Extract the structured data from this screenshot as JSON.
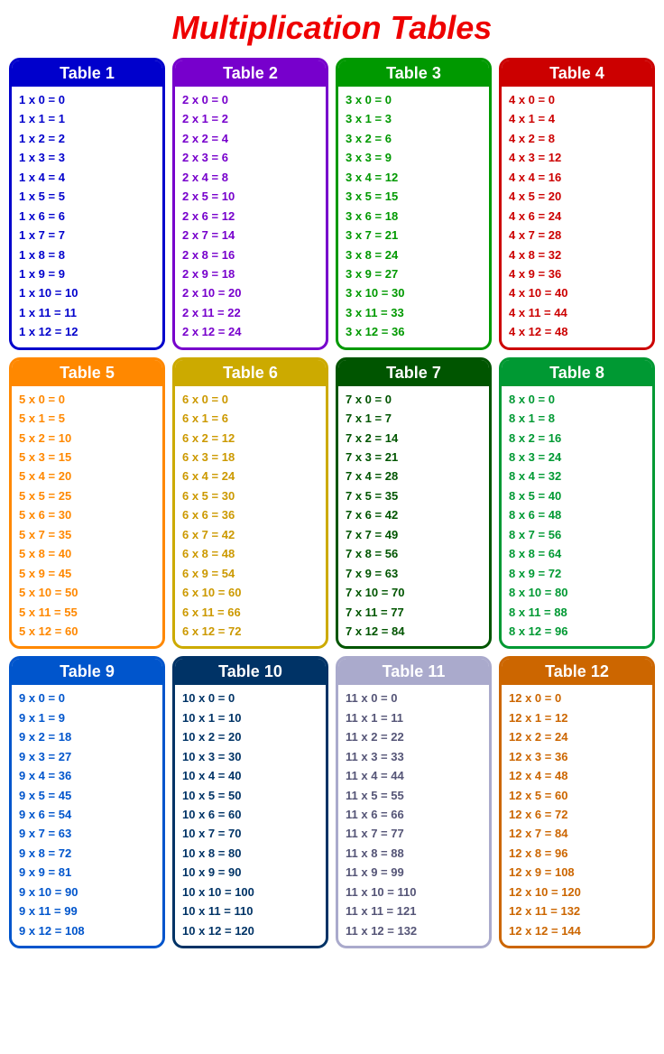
{
  "title": "Multiplication Tables",
  "tables": [
    {
      "id": 1,
      "label": "Table 1",
      "rows": [
        "1 x 0 = 0",
        "1 x 1 = 1",
        "1 x 2 = 2",
        "1 x 3 = 3",
        "1 x 4 = 4",
        "1 x 5 = 5",
        "1 x 6 = 6",
        "1 x 7 = 7",
        "1 x 8 = 8",
        "1 x 9 = 9",
        "1 x 10 = 10",
        "1 x 11 = 11",
        "1 x 12 = 12"
      ]
    },
    {
      "id": 2,
      "label": "Table 2",
      "rows": [
        "2 x 0 = 0",
        "2 x 1 = 2",
        "2 x 2 = 4",
        "2 x 3 = 6",
        "2 x 4 = 8",
        "2 x 5 = 10",
        "2 x 6 = 12",
        "2 x 7 = 14",
        "2 x 8 = 16",
        "2 x 9 = 18",
        "2 x 10 = 20",
        "2 x 11 = 22",
        "2 x 12 = 24"
      ]
    },
    {
      "id": 3,
      "label": "Table 3",
      "rows": [
        "3 x 0 = 0",
        "3 x 1 = 3",
        "3 x 2 = 6",
        "3 x 3 = 9",
        "3 x 4 = 12",
        "3 x 5 = 15",
        "3 x 6 = 18",
        "3 x 7 = 21",
        "3 x 8 = 24",
        "3 x 9 = 27",
        "3 x 10 = 30",
        "3 x 11 = 33",
        "3 x 12 = 36"
      ]
    },
    {
      "id": 4,
      "label": "Table 4",
      "rows": [
        "4 x 0 = 0",
        "4 x 1 = 4",
        "4 x 2 = 8",
        "4 x 3 = 12",
        "4 x 4 = 16",
        "4 x 5 = 20",
        "4 x 6 = 24",
        "4 x 7 = 28",
        "4 x 8 = 32",
        "4 x 9 = 36",
        "4 x 10 = 40",
        "4 x 11 = 44",
        "4 x 12 = 48"
      ]
    },
    {
      "id": 5,
      "label": "Table 5",
      "rows": [
        "5 x 0 = 0",
        "5 x 1 = 5",
        "5 x 2 = 10",
        "5 x 3 = 15",
        "5 x 4 = 20",
        "5 x 5 = 25",
        "5 x 6 = 30",
        "5 x 7 = 35",
        "5 x 8 = 40",
        "5 x 9 = 45",
        "5 x 10 = 50",
        "5 x 11 = 55",
        "5 x 12 = 60"
      ]
    },
    {
      "id": 6,
      "label": "Table 6",
      "rows": [
        "6 x 0 = 0",
        "6 x 1 = 6",
        "6 x 2 = 12",
        "6 x 3 = 18",
        "6 x 4 = 24",
        "6 x 5 = 30",
        "6 x 6 = 36",
        "6 x 7 = 42",
        "6 x 8 = 48",
        "6 x 9 = 54",
        "6 x 10 = 60",
        "6 x 11 = 66",
        "6 x 12 = 72"
      ]
    },
    {
      "id": 7,
      "label": "Table 7",
      "rows": [
        "7 x 0 = 0",
        "7 x 1 = 7",
        "7 x 2 = 14",
        "7 x 3 = 21",
        "7 x 4 = 28",
        "7 x 5 = 35",
        "7 x 6 = 42",
        "7 x 7 = 49",
        "7 x 8 = 56",
        "7 x 9 = 63",
        "7 x 10 = 70",
        "7 x 11 = 77",
        "7 x 12 = 84"
      ]
    },
    {
      "id": 8,
      "label": "Table 8",
      "rows": [
        "8 x 0 = 0",
        "8 x 1 = 8",
        "8 x 2 = 16",
        "8 x 3 = 24",
        "8 x 4 = 32",
        "8 x 5 = 40",
        "8 x 6 = 48",
        "8 x 7 = 56",
        "8 x 8 = 64",
        "8 x 9 = 72",
        "8 x 10 = 80",
        "8 x 11 = 88",
        "8 x 12 = 96"
      ]
    },
    {
      "id": 9,
      "label": "Table 9",
      "rows": [
        "9 x 0 = 0",
        "9 x 1 = 9",
        "9 x 2 = 18",
        "9 x 3 = 27",
        "9 x 4 = 36",
        "9 x 5 = 45",
        "9 x 6 = 54",
        "9 x 7 = 63",
        "9 x 8 = 72",
        "9 x 9 = 81",
        "9 x 10 = 90",
        "9 x 11 = 99",
        "9 x 12 = 108"
      ]
    },
    {
      "id": 10,
      "label": "Table 10",
      "rows": [
        "10 x 0 = 0",
        "10 x 1 = 10",
        "10 x 2 = 20",
        "10 x 3 = 30",
        "10 x 4 = 40",
        "10 x 5 = 50",
        "10 x 6 = 60",
        "10 x 7 = 70",
        "10 x 8 = 80",
        "10 x 9 = 90",
        "10 x 10 = 100",
        "10 x 11 = 110",
        "10 x 12 = 120"
      ]
    },
    {
      "id": 11,
      "label": "Table 11",
      "rows": [
        "11 x 0 = 0",
        "11 x 1 = 11",
        "11 x 2 = 22",
        "11 x 3 = 33",
        "11 x 4 = 44",
        "11 x 5 = 55",
        "11 x 6 = 66",
        "11 x 7 = 77",
        "11 x 8 = 88",
        "11 x 9 = 99",
        "11 x 10 = 110",
        "11 x 11 = 121",
        "11 x 12 = 132"
      ]
    },
    {
      "id": 12,
      "label": "Table 12",
      "rows": [
        "12 x 0 = 0",
        "12 x 1 = 12",
        "12 x 2 = 24",
        "12 x 3 = 36",
        "12 x 4 = 48",
        "12 x 5 = 60",
        "12 x 6 = 72",
        "12 x 7 = 84",
        "12 x 8 = 96",
        "12 x 9 = 108",
        "12 x 10 = 120",
        "12 x 11 = 132",
        "12 x 12 = 144"
      ]
    }
  ]
}
